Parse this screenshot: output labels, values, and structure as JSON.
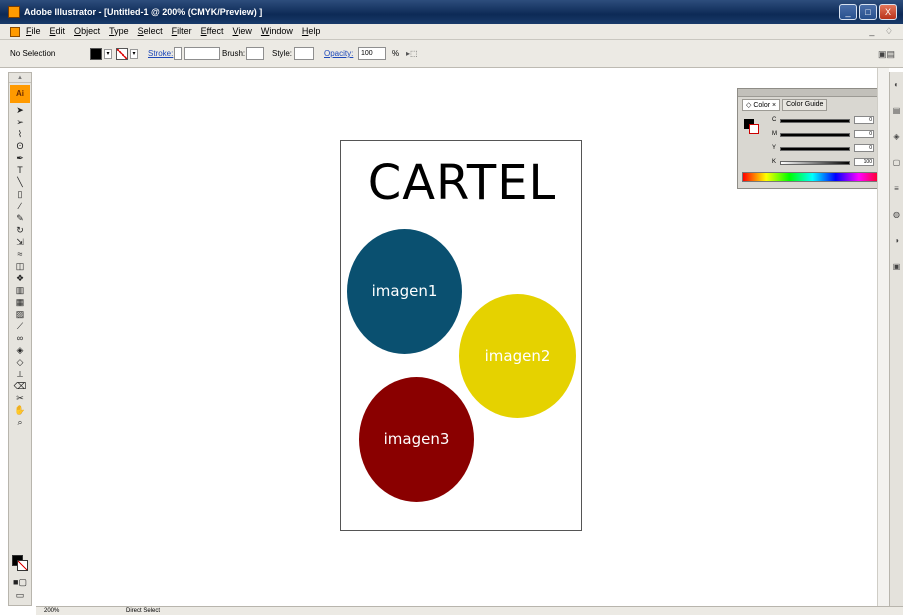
{
  "window": {
    "title": "Adobe Illustrator - [Untitled-1 @ 200% (CMYK/Preview) ]",
    "buttons": [
      "_",
      "□",
      "X"
    ]
  },
  "menu": {
    "items": [
      "File",
      "Edit",
      "Object",
      "Type",
      "Select",
      "Filter",
      "Effect",
      "View",
      "Window",
      "Help"
    ],
    "mdi": "_ ♢"
  },
  "control_bar": {
    "selection_label": "No Selection",
    "stroke_label": "Stroke:",
    "brush_label": "Brush:",
    "style_label": "Style:",
    "opacity_label": "Opacity:",
    "opacity_value": "100",
    "opacity_unit": "%"
  },
  "toolbox": {
    "logo": "Ai",
    "tools": [
      "selection-tool",
      "direct-selection-tool",
      "magic-wand-tool",
      "lasso-tool",
      "pen-tool",
      "type-tool",
      "line-tool",
      "rectangle-tool",
      "paintbrush-tool",
      "pencil-tool",
      "rotate-tool",
      "scale-tool",
      "warp-tool",
      "free-transform-tool",
      "symbol-sprayer-tool",
      "column-graph-tool",
      "mesh-tool",
      "gradient-tool",
      "eyedropper-tool",
      "blend-tool",
      "live-paint-tool",
      "live-paint-selection-tool",
      "slice-tool",
      "eraser-tool",
      "scissors-tool",
      "hand-tool",
      "zoom-tool"
    ]
  },
  "artwork": {
    "title": "CARTEL",
    "circles": [
      {
        "label": "imagen1",
        "color": "#0a5070"
      },
      {
        "label": "imagen2",
        "color": "#e5d200"
      },
      {
        "label": "imagen3",
        "color": "#8a0000"
      }
    ]
  },
  "color_panel": {
    "tab_color": "◇ Color ×",
    "tab_guide": "Color Guide",
    "channels": [
      {
        "name": "C",
        "value": "0"
      },
      {
        "name": "M",
        "value": "0"
      },
      {
        "name": "Y",
        "value": "0"
      },
      {
        "name": "K",
        "value": "100"
      }
    ],
    "unit": "%"
  },
  "status_bar": {
    "zoom": "200%",
    "mode": "Direct Select"
  }
}
